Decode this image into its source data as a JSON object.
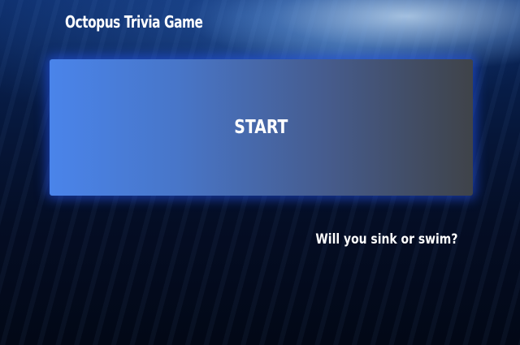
{
  "app": {
    "title": "Octopus Trivia Game"
  },
  "main": {
    "start_label": "START",
    "tagline": "Will you sink or swim?"
  },
  "colors": {
    "button_gradient_start": "#4a84ea",
    "button_gradient_end": "#3f4349",
    "glow": "#2859ff",
    "background_deep": "#020816",
    "text": "#ffffff"
  }
}
